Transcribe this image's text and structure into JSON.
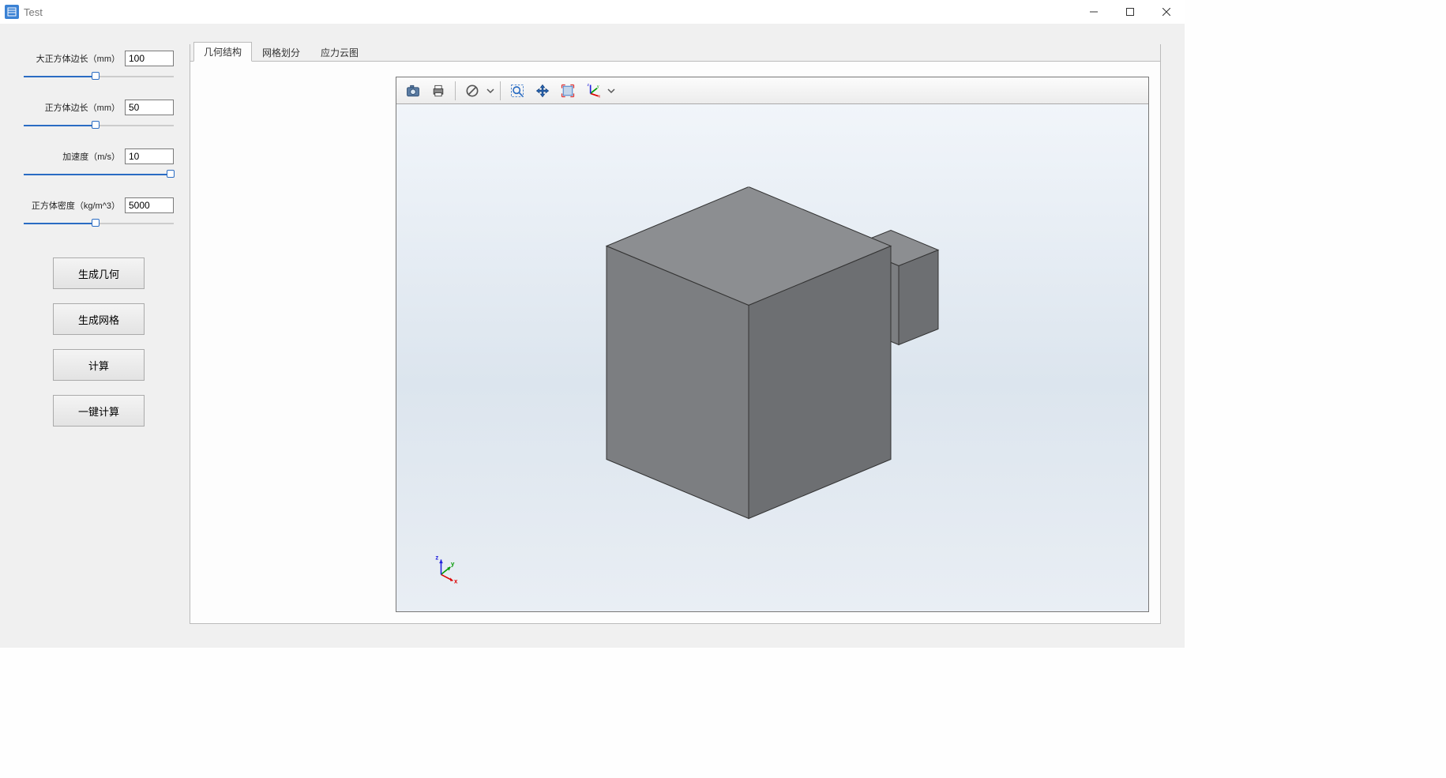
{
  "window": {
    "title": "Test"
  },
  "params": [
    {
      "label": "大正方体边长（mm）",
      "value": "100",
      "fill": 48
    },
    {
      "label": "正方体边长（mm）",
      "value": "50",
      "fill": 48
    },
    {
      "label": "加速度（m/s）",
      "value": "10",
      "fill": 98
    },
    {
      "label": "正方体密度（kg/m^3）",
      "value": "5000",
      "fill": 48
    }
  ],
  "buttons": {
    "gen_geometry": "生成几何",
    "gen_mesh": "生成网格",
    "compute": "计算",
    "one_click": "一键计算"
  },
  "tabs": [
    {
      "id": "geom",
      "label": "几何结构",
      "active": true
    },
    {
      "id": "mesh",
      "label": "网格划分",
      "active": false
    },
    {
      "id": "stress",
      "label": "应力云图",
      "active": false
    }
  ],
  "toolbar_icons": [
    "camera-icon",
    "print-icon",
    "sep",
    "cancel-icon",
    "dropdown",
    "sep",
    "zoom-box-icon",
    "pan-icon",
    "fit-icon",
    "axes-orient-icon",
    "dropdown"
  ],
  "axes_labels": {
    "x": "x",
    "y": "y",
    "z": "z"
  }
}
